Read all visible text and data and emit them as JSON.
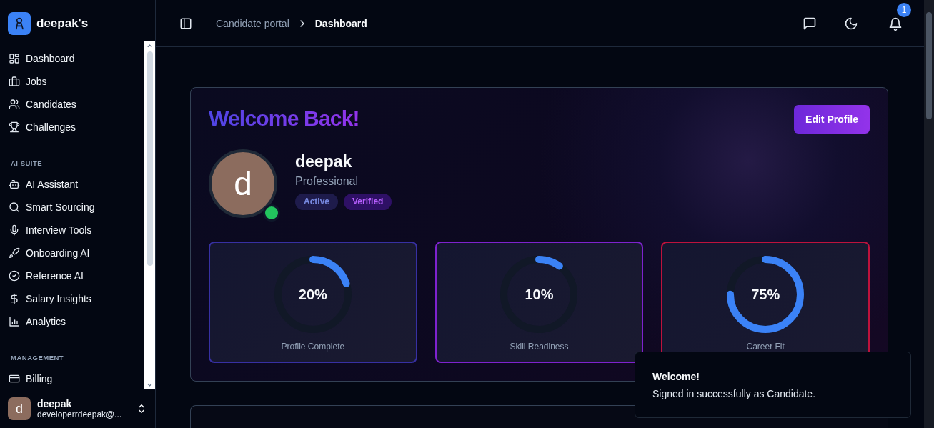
{
  "sidebar": {
    "brand": "deepak's",
    "sections": [
      {
        "items": [
          {
            "label": "Dashboard"
          },
          {
            "label": "Jobs"
          },
          {
            "label": "Candidates"
          },
          {
            "label": "Challenges"
          }
        ]
      },
      {
        "title": "AI SUITE",
        "items": [
          {
            "label": "AI Assistant"
          },
          {
            "label": "Smart Sourcing"
          },
          {
            "label": "Interview Tools"
          },
          {
            "label": "Onboarding AI"
          },
          {
            "label": "Reference AI"
          },
          {
            "label": "Salary Insights"
          },
          {
            "label": "Analytics"
          }
        ]
      },
      {
        "title": "MANAGEMENT",
        "items": [
          {
            "label": "Billing"
          }
        ]
      }
    ],
    "user": {
      "initial": "d",
      "name": "deepak",
      "email": "developerrdeepak@..."
    }
  },
  "header": {
    "breadcrumb": [
      "Candidate portal",
      "Dashboard"
    ],
    "notification_count": "1"
  },
  "welcome": {
    "title": "Welcome Back!",
    "button": "Edit Profile",
    "profile": {
      "initial": "d",
      "name": "deepak",
      "role": "Professional",
      "online": true,
      "badges": [
        {
          "label": "Active",
          "color": "#1e1b4b"
        },
        {
          "label": "Verified",
          "color": "#2e1065"
        }
      ]
    },
    "metrics": [
      {
        "value": "20%",
        "label": "Profile Complete",
        "level": 0.2,
        "color": "#3730a3"
      },
      {
        "value": "10%",
        "label": "Skill Readiness",
        "level": 0.1,
        "color": "#7e22ce"
      },
      {
        "value": "75%",
        "label": "Career Fit",
        "level": 0.75,
        "color": "#be123c"
      }
    ]
  },
  "toast": {
    "title": "Welcome!",
    "message": "Signed in successfully as Candidate."
  }
}
